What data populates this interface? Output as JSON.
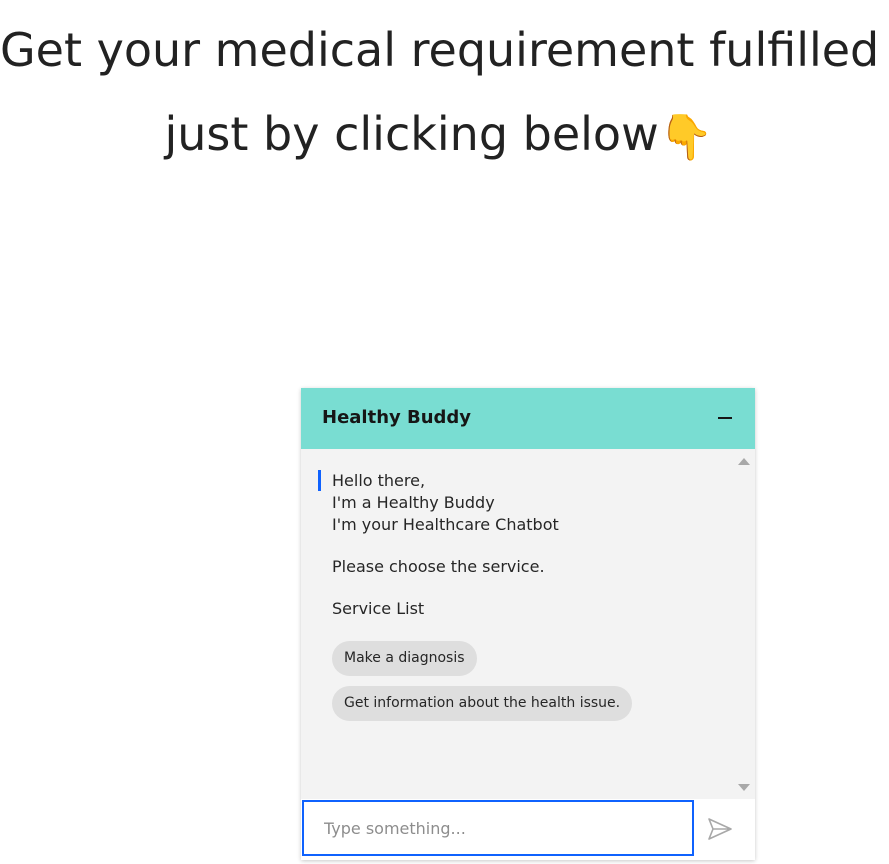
{
  "headline": {
    "line1": "Get your medical requirement fulfilled",
    "line2": "just by clicking below",
    "emoji": "👇"
  },
  "chat": {
    "title": "Healthy Buddy",
    "minimize_icon": "minimize-icon",
    "greeting": [
      "Hello there,",
      "I'm a Healthy Buddy",
      "I'm your Healthcare Chatbot"
    ],
    "prompt": "Please choose the service.",
    "service_list_label": "Service List",
    "options": [
      "Make a diagnosis",
      "Get information about the health issue."
    ],
    "input_placeholder": "Type something...",
    "input_value": "",
    "send_icon": "send-icon"
  },
  "colors": {
    "header_bg": "#79ddd2",
    "accent": "#0f62fe",
    "chat_bg": "#f3f3f3",
    "option_bg": "#dedede"
  }
}
